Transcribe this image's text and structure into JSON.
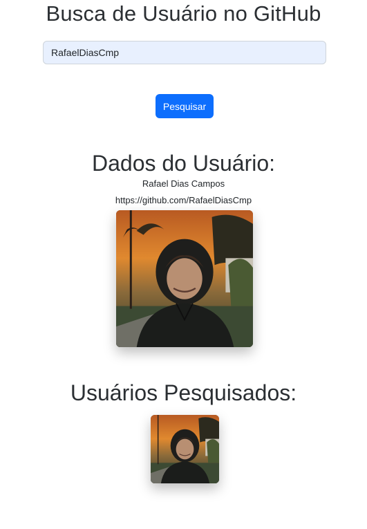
{
  "page": {
    "title": "Busca de Usuário no GitHub"
  },
  "search": {
    "value": "RafaelDiasCmp",
    "button_label": "Pesquisar"
  },
  "user": {
    "section_title": "Dados do Usuário:",
    "name": "Rafael Dias Campos",
    "url": "https://github.com/RafaelDiasCmp",
    "avatar_icon": "user-avatar-photo"
  },
  "history": {
    "section_title": "Usuários Pesquisados:",
    "avatars": [
      "user-avatar-photo"
    ]
  },
  "colors": {
    "primary": "#0d6efd",
    "input_background": "#e8f0fe",
    "text": "#212529"
  }
}
